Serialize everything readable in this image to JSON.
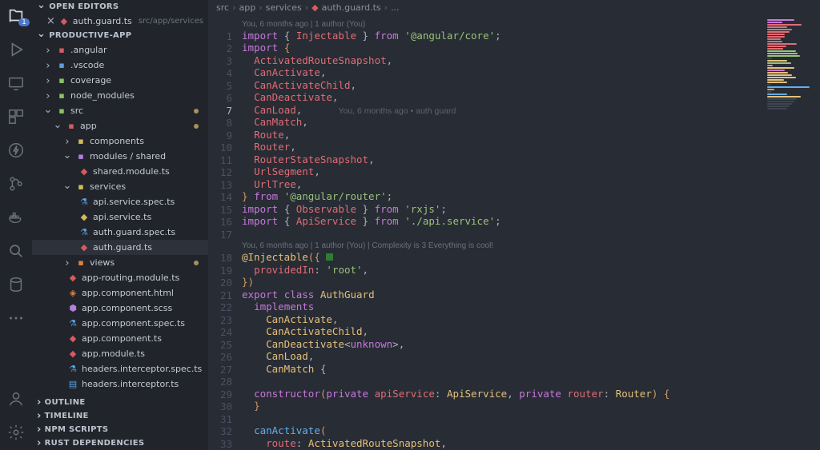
{
  "activity_badge": "1",
  "sidebar": {
    "sections": {
      "open_editors": "OPEN EDITORS",
      "project": "PRODUCTIVE-APP",
      "outline": "OUTLINE",
      "timeline": "TIMELINE",
      "npm": "NPM SCRIPTS",
      "rust": "RUST DEPENDENCIES"
    },
    "open_editor_file": "auth.guard.ts",
    "open_editor_path": "src/app/services",
    "tree": {
      "angular": ".angular",
      "vscode": ".vscode",
      "coverage": "coverage",
      "node_modules": "node_modules",
      "src": "src",
      "app": "app",
      "components": "components",
      "modules_shared": "modules / shared",
      "shared_module": "shared.module.ts",
      "services": "services",
      "api_spec": "api.service.spec.ts",
      "api_service": "api.service.ts",
      "auth_spec": "auth.guard.spec.ts",
      "auth_guard": "auth.guard.ts",
      "views": "views",
      "app_routing": "app-routing.module.ts",
      "app_html": "app.component.html",
      "app_scss": "app.component.scss",
      "app_spec": "app.component.spec.ts",
      "app_ts": "app.component.ts",
      "app_module": "app.module.ts",
      "headers_spec": "headers.interceptor.spec.ts",
      "headers_ts": "headers.interceptor.ts"
    }
  },
  "breadcrumb": {
    "p0": "src",
    "p1": "app",
    "p2": "services",
    "p3": "auth.guard.ts",
    "p4": "..."
  },
  "codelens": {
    "line1": "You, 6 months ago | 1 author (You)",
    "line18": "You, 6 months ago | 1 author (You) | Complexity is 3 Everything is cool!"
  },
  "inline_blame": "You, 6 months ago • auth guard",
  "code": {
    "l1": {
      "import": "import",
      "braceL": "{",
      "Injectable": "Injectable",
      "braceR": "}",
      "from": "from",
      "mod": "'@angular/core'",
      "semi": ";"
    },
    "l2": {
      "import": "import",
      "braceL": "{"
    },
    "l3": "ActivatedRouteSnapshot",
    "l4": "CanActivate",
    "l5": "CanActivateChild",
    "l6": "CanDeactivate",
    "l7": "CanLoad",
    "l8": "CanMatch",
    "l9": "Route",
    "l10": "Router",
    "l11": "RouterStateSnapshot",
    "l12": "UrlSegment",
    "l13": "UrlTree",
    "l14": {
      "braceR": "}",
      "from": "from",
      "mod": "'@angular/router'",
      "semi": ";"
    },
    "l15": {
      "import": "import",
      "braceL": "{",
      "name": "Observable",
      "braceR": "}",
      "from": "from",
      "mod": "'rxjs'",
      "semi": ";"
    },
    "l16": {
      "import": "import",
      "braceL": "{",
      "name": "ApiService",
      "braceR": "}",
      "from": "from",
      "mod": "'./api.service'",
      "semi": ";"
    },
    "l18": {
      "deco": "@Injectable",
      "paren": "({"
    },
    "l19": {
      "key": "providedIn",
      "colon": ": ",
      "val": "'root'",
      "comma": ","
    },
    "l20": "})",
    "l21": {
      "export": "export",
      "classkw": "class",
      "name": "AuthGuard"
    },
    "l22": "implements",
    "l23": "CanActivate",
    "l24": "CanActivateChild",
    "l25": {
      "name": "CanDeactivate",
      "lt": "<",
      "unk": "unknown",
      "gt": ">"
    },
    "l26": "CanLoad",
    "l27": {
      "name": "CanMatch",
      "brace": " {"
    },
    "l29": {
      "ctor": "constructor",
      "open": "(",
      "priv1": "private",
      "arg1": "apiService",
      "c1": ": ",
      "t1": "ApiService",
      "comma": ", ",
      "priv2": "private",
      "arg2": "router",
      "c2": ": ",
      "t2": "Router",
      "close": ") {"
    },
    "l30": "}",
    "l32": {
      "name": "canActivate",
      "open": "("
    },
    "l33": {
      "arg": "route",
      "colon": ": ",
      "type": "ActivatedRouteSnapshot",
      "comma": ","
    }
  }
}
